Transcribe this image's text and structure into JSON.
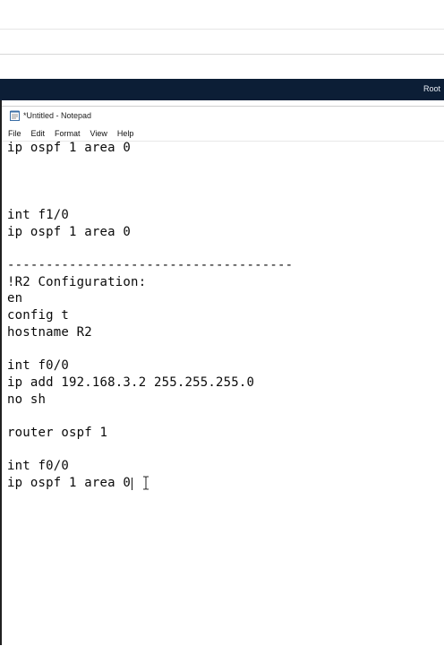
{
  "taskbar": {
    "label": "Root"
  },
  "window": {
    "title": "*Untitled - Notepad",
    "menu": [
      "File",
      "Edit",
      "Format",
      "View",
      "Help"
    ]
  },
  "editor": {
    "lines": [
      "ip ospf 1 area 0",
      "",
      "",
      "",
      "int f1/0",
      "ip ospf 1 area 0",
      "",
      "-------------------------------------",
      "!R2 Configuration:",
      "en",
      "config t",
      "hostname R2",
      "",
      "int f0/0",
      "ip add 192.168.3.2 255.255.255.0",
      "no sh",
      "",
      "router ospf 1",
      "",
      "int f0/0",
      "ip ospf 1 area 0"
    ]
  }
}
